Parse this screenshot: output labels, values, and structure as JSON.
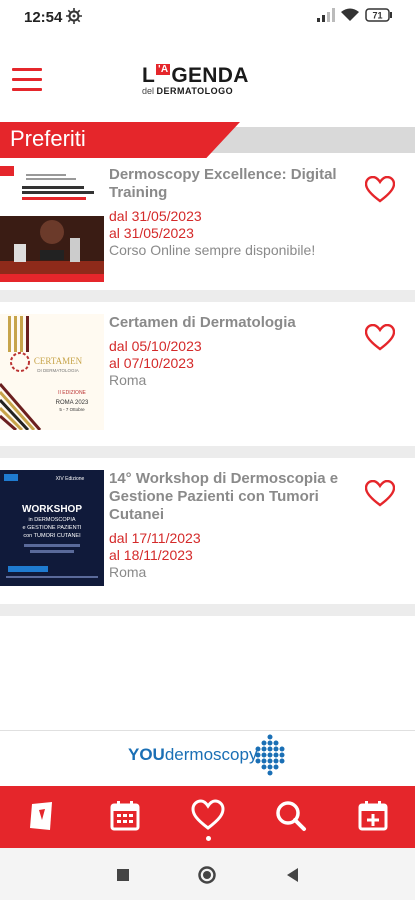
{
  "status": {
    "time": "12:54",
    "battery": "71"
  },
  "header": {
    "logo_prefix": "L",
    "logo_badge": "'A",
    "logo_main": "GENDA",
    "logo_sub_prefix": "del ",
    "logo_sub_main": "DERMATOLOGO"
  },
  "section": {
    "title": "Preferiti"
  },
  "events": [
    {
      "title": "Dermoscopy Excellence: Digital Training",
      "date_from": "dal 31/05/2023",
      "date_to": "al 31/05/2023",
      "location": "Corso Online sempre disponibile!",
      "thumb_caption": "IL CORSO COMPLETO SUI CRITERI FONDAMENTALI DELLA DERMOSCOPIA"
    },
    {
      "title": "Certamen di Dermatologia",
      "date_from": "dal 05/10/2023",
      "date_to": "al 07/10/2023",
      "location": "Roma",
      "thumb_caption": "CERTAMEN",
      "thumb_sub": "DI DERMATOLOGIA",
      "thumb_edition": "II EDIZIONE",
      "thumb_city": "ROMA 2023",
      "thumb_days": "5 - 7 Ottobre"
    },
    {
      "title": "14° Workshop di Dermoscopia e Gestione Pazienti con Tumori Cutanei",
      "date_from": "dal 17/11/2023",
      "date_to": "al 18/11/2023",
      "location": "Roma",
      "thumb_caption": "WORKSHOP",
      "thumb_sub": "in DERMOSCOPIA",
      "thumb_line2": "e GESTIONE PAZIENTI",
      "thumb_line3": "con TUMORI CUTANEI",
      "thumb_edition": "XIV Edizione"
    }
  ],
  "brand": {
    "part1": "YOU",
    "part2": "dermoscopy"
  },
  "tabs": [
    {
      "name": "tab-home",
      "icon": "book-icon"
    },
    {
      "name": "tab-calendar",
      "icon": "calendar-icon"
    },
    {
      "name": "tab-favorites",
      "icon": "heart-icon",
      "active": true
    },
    {
      "name": "tab-search",
      "icon": "search-icon"
    },
    {
      "name": "tab-add-event",
      "icon": "calendar-plus-icon"
    }
  ],
  "colors": {
    "accent": "#e5262b",
    "date": "#d42a2a",
    "muted": "#8a8a8a",
    "brand": "#1a6fb5"
  }
}
